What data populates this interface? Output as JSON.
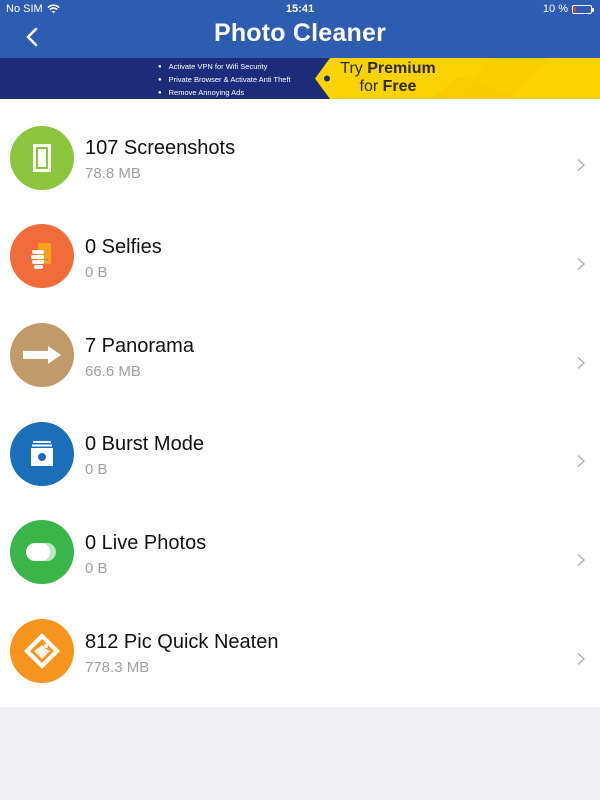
{
  "status_bar": {
    "carrier": "No SIM",
    "time": "15:41",
    "battery": "10 %",
    "battery_level": 0.1
  },
  "header": {
    "title": "Photo Cleaner",
    "back_icon": "chevron-left-icon",
    "background_color": "#2e5cb0"
  },
  "banner": {
    "features": [
      "Activate VPN for Wifi Security",
      "Private Browser & Activate Anti Theft",
      "Remove Annoying Ads"
    ],
    "promo_try": "Try",
    "promo_premium": "Premium",
    "promo_for": "for",
    "promo_free": "Free",
    "promo_color": "#fcd302"
  },
  "items": [
    {
      "title": "107 Screenshots",
      "size": "78.8 MB",
      "icon": "screenshot-icon",
      "color": "#8cc63f"
    },
    {
      "title": "0 Selfies",
      "size": "0 B",
      "icon": "selfie-hand-icon",
      "color": "#f26b3a"
    },
    {
      "title": "7 Panorama",
      "size": "66.6 MB",
      "icon": "panorama-arrow-icon",
      "color": "#c19a6b"
    },
    {
      "title": "0 Burst Mode",
      "size": "0 B",
      "icon": "burst-mode-icon",
      "color": "#1b6fb8"
    },
    {
      "title": "0 Live Photos",
      "size": "0 B",
      "icon": "live-photos-icon",
      "color": "#3bb44a"
    },
    {
      "title": "812 Pic Quick Neaten",
      "size": "778.3 MB",
      "icon": "quick-neaten-icon",
      "color": "#f5951d"
    }
  ]
}
